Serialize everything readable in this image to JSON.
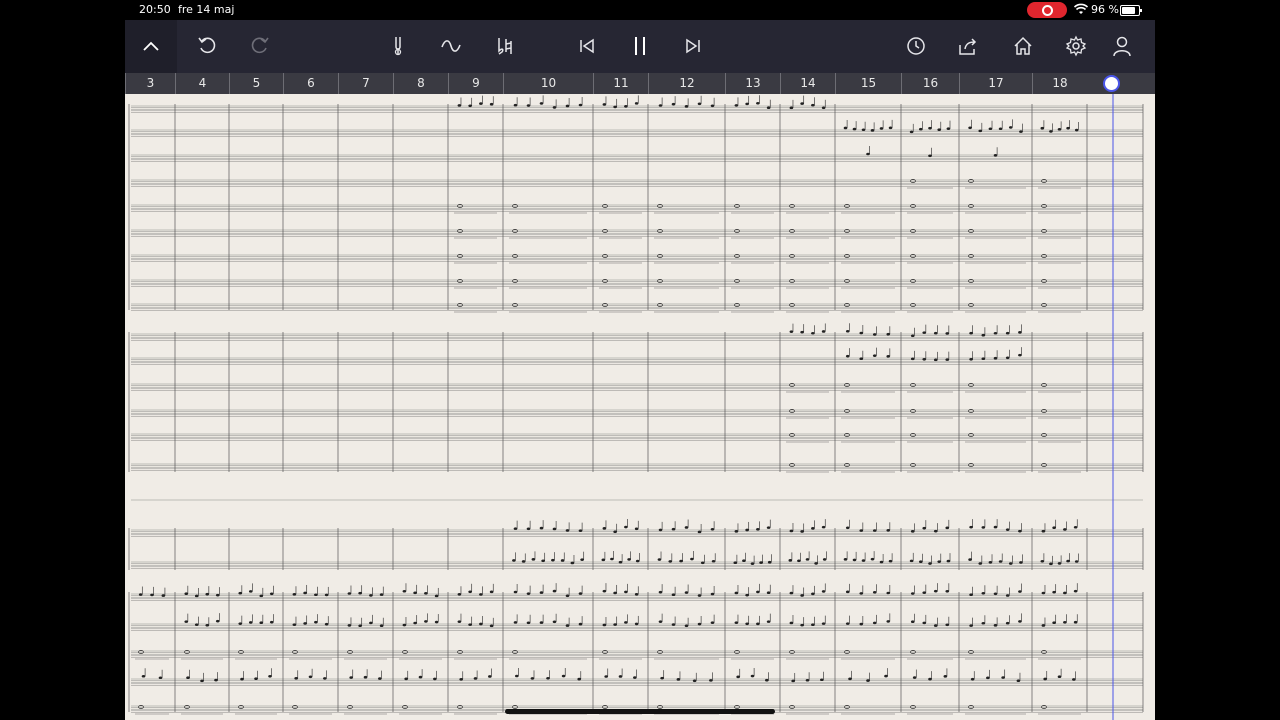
{
  "status_bar": {
    "time": "20:50",
    "date": "fre 14 maj",
    "battery": "96 %",
    "battery_level": 0.96,
    "recording": true
  },
  "toolbar": {
    "icons": [
      "chevron-up-icon",
      "undo-icon",
      "redo-icon",
      "tuning-fork-icon",
      "slur-icon",
      "accidental-icon",
      "skip-back-icon",
      "pause-icon",
      "skip-forward-icon",
      "clock-icon",
      "share-icon",
      "home-icon",
      "gear-icon",
      "user-icon"
    ]
  },
  "ruler": {
    "measures": [
      "3",
      "4",
      "5",
      "6",
      "7",
      "8",
      "9",
      "10",
      "11",
      "12",
      "13",
      "14",
      "15",
      "16",
      "17",
      "18"
    ]
  },
  "colors": {
    "toolbar_bg": "#262633",
    "ruler_bg": "#3a3a42",
    "paper": "#f0ece6",
    "playhead": "#4a55e8",
    "record": "#e0262e"
  },
  "playback": {
    "state": "playing",
    "current_measure": 19
  }
}
